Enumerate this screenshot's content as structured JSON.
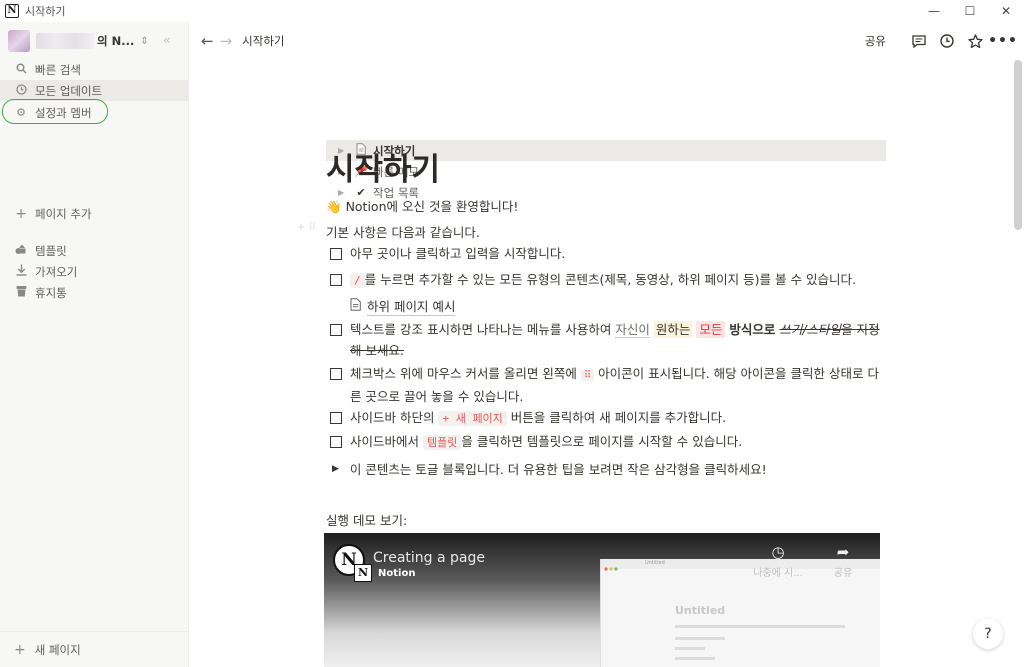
{
  "window": {
    "title": "시작하기",
    "controls": [
      "minimize",
      "maximize",
      "close"
    ]
  },
  "sidebar": {
    "workspace_name": "의 N...",
    "nav": [
      {
        "label": "빠른 검색",
        "icon": "search-icon"
      },
      {
        "label": "모든 업데이트",
        "icon": "clock-icon"
      },
      {
        "label": "설정과 멤버",
        "icon": "gear-icon"
      }
    ],
    "pages": [
      {
        "label": "시작하기",
        "icon": "document-icon",
        "active": true
      },
      {
        "label": "빠른 메모",
        "icon": "pin-icon"
      },
      {
        "label": "작업 목록",
        "icon": "checkmark-icon"
      }
    ],
    "add_page": "페이지 추가",
    "tools": [
      {
        "label": "템플릿",
        "icon": "shapes-icon"
      },
      {
        "label": "가져오기",
        "icon": "download-icon"
      },
      {
        "label": "휴지통",
        "icon": "trash-icon"
      }
    ],
    "new_page": "새 페이지"
  },
  "topbar": {
    "breadcrumb": "시작하기",
    "share": "공유"
  },
  "page": {
    "title": "시작하기",
    "welcome_emoji": "👋",
    "welcome": "Notion에 오신 것을 환영합니다!",
    "intro": "기본 사항은 다음과 같습니다.",
    "todo1": "아무 곳이나 클릭하고 입력을 시작합니다.",
    "todo2_code": "/",
    "todo2_rest": "를 누르면 추가할 수 있는 모든 유형의 콘텐츠(제목, 동영상, 하위 페이지 등)를 볼 수 있습니다.",
    "subpage": "하위 페이지 예시",
    "todo3_a": "텍스트를 강조 표시하면 나타나는 메뉴를 사용하여 ",
    "todo3_b": "자신이",
    "todo3_c": "원하는",
    "todo3_d": "모든",
    "todo3_e": "방식으로",
    "todo3_f": "쓰기/스타일",
    "todo3_g": "을 지정해 보세요.",
    "todo4_a": "체크박스 위에 마우스 커서를 올리면 왼쪽에 ",
    "todo4_dots": "⠿",
    "todo4_b": " 아이콘이 표시됩니다. 해당 아이콘을 클릭한 상태로 다른 곳으로 끌어 놓을 수 있습니다.",
    "todo5_a": "사이드바 하단의 ",
    "todo5_code": "+ 새 페이지",
    "todo5_b": " 버튼을 클릭하여 새 페이지를 추가합니다.",
    "todo6_a": "사이드바에서 ",
    "todo6_code": "템플릿",
    "todo6_b": "을 클릭하면 템플릿으로 페이지를 시작할 수 있습니다.",
    "toggle": "이 콘텐츠는 토글 블록입니다. 더 유용한 팁을 보려면 작은 삼각형을 클릭하세요!",
    "demo_heading": "실행 데모 보기:"
  },
  "video": {
    "title": "Creating a page",
    "channel": "Notion",
    "watch_later": "나중에 시...",
    "share": "공유",
    "inner_title": "Untitled",
    "inner_crumb": "Untitled"
  },
  "help": "?"
}
